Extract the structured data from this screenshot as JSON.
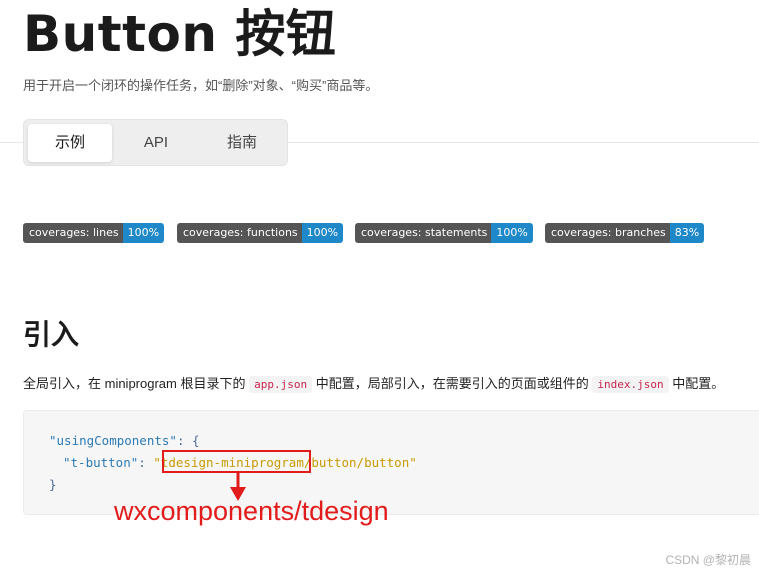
{
  "page": {
    "title": "Button 按钮",
    "description": "用于开启一个闭环的操作任务，如“删除”对象、“购买”商品等。"
  },
  "tabs": [
    {
      "label": "示例",
      "active": true
    },
    {
      "label": "API",
      "active": false
    },
    {
      "label": "指南",
      "active": false
    }
  ],
  "badges": [
    {
      "label": "coverages: lines",
      "value": "100%",
      "color": "#1e88c9"
    },
    {
      "label": "coverages: functions",
      "value": "100%",
      "color": "#1e88c9"
    },
    {
      "label": "coverages: statements",
      "value": "100%",
      "color": "#1e88c9"
    },
    {
      "label": "coverages: branches",
      "value": "83%",
      "color": "#1e88c9"
    }
  ],
  "section": {
    "heading": "引入",
    "intro_part1": "全局引入，在 miniprogram 根目录下的",
    "intro_code1": "app.json",
    "intro_part2": "中配置，局部引入，在需要引入的页面或组件的",
    "intro_code2": "index.json",
    "intro_part3": "中配置。"
  },
  "code": {
    "line1_key": "\"usingComponents\"",
    "line1_rest": ": {",
    "line2_key": "\"t-button\"",
    "line2_colon": ": ",
    "line2_quote": "\"",
    "line2_highlight": "tdesign-miniprogram",
    "line2_tail": "/button/button\"",
    "line3": "}"
  },
  "annotation": {
    "text": "wxcomponents/tdesign",
    "color": "#e21b1b"
  },
  "watermark": "CSDN @黎初晨"
}
